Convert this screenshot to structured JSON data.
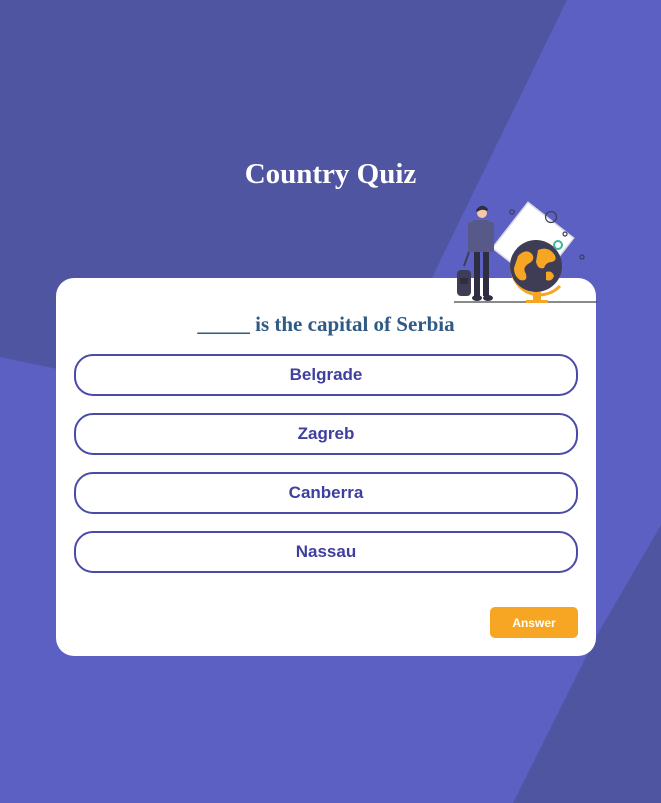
{
  "app": {
    "title": "Country Quiz"
  },
  "question": {
    "text": "_____ is the capital of Serbia"
  },
  "options": [
    {
      "label": "Belgrade"
    },
    {
      "label": "Zagreb"
    },
    {
      "label": "Canberra"
    },
    {
      "label": "Nassau"
    }
  ],
  "actions": {
    "answer_label": "Answer"
  },
  "colors": {
    "background": "#5b60c2",
    "background_dark": "#5055a2",
    "card": "#ffffff",
    "option_border": "#4a4aa8",
    "option_text": "#3f3fa0",
    "question_text": "#2f5a83",
    "accent": "#f6a623"
  },
  "illustration": {
    "icon": "traveler-globe-illustration"
  }
}
